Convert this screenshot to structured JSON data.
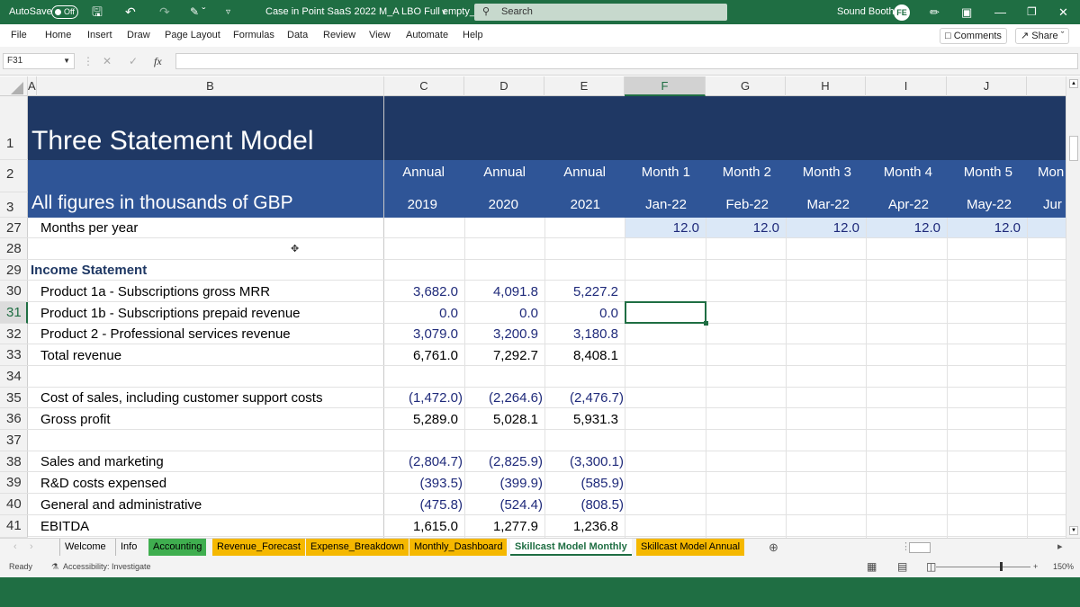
{
  "titlebar": {
    "autosave_label": "AutoSave",
    "autosave_state": "Off",
    "file_title": "Case in Point SaaS 2022 M_A LBO Full empty_6",
    "search_placeholder": "Search",
    "user_name": "Sound Booth",
    "user_initials": "FE"
  },
  "menu": [
    "File",
    "Home",
    "Insert",
    "Draw",
    "Page Layout",
    "Formulas",
    "Data",
    "Review",
    "View",
    "Automate",
    "Help"
  ],
  "comments_label": "Comments",
  "share_label": "Share",
  "formula_bar": {
    "name_box": "F31",
    "fx": "fx",
    "formula": ""
  },
  "columns": [
    "A",
    "B",
    "C",
    "D",
    "E",
    "F",
    "G",
    "H",
    "I",
    "J"
  ],
  "selected_column": "F",
  "rows": {
    "r1": {
      "num": "1",
      "title": "Three Statement Model"
    },
    "r2": {
      "num": "2",
      "headers": [
        "Annual",
        "Annual",
        "Annual",
        "Month 1",
        "Month 2",
        "Month 3",
        "Month 4",
        "Month 5",
        "Mon"
      ]
    },
    "r3": {
      "num": "3",
      "label": "All figures in thousands of GBP",
      "headers": [
        "2019",
        "2020",
        "2021",
        "Jan-22",
        "Feb-22",
        "Mar-22",
        "Apr-22",
        "May-22",
        "Jur"
      ]
    },
    "r27": {
      "num": "27",
      "label": "Months per year",
      "values": [
        "12.0",
        "12.0",
        "12.0",
        "12.0",
        "12.0"
      ]
    },
    "r28": {
      "num": "28"
    },
    "r29": {
      "num": "29",
      "label": "Income Statement"
    },
    "r30": {
      "num": "30",
      "label": "Product 1a - Subscriptions gross MRR",
      "values": [
        "3,682.0",
        "4,091.8",
        "5,227.2"
      ]
    },
    "r31": {
      "num": "31",
      "label": "Product 1b - Subscriptions prepaid revenue",
      "values": [
        "0.0",
        "0.0",
        "0.0"
      ]
    },
    "r32": {
      "num": "32",
      "label": "Product 2 - Professional services revenue",
      "values": [
        "3,079.0",
        "3,200.9",
        "3,180.8"
      ]
    },
    "r33": {
      "num": "33",
      "label": "Total revenue",
      "values": [
        "6,761.0",
        "7,292.7",
        "8,408.1"
      ]
    },
    "r34": {
      "num": "34"
    },
    "r35": {
      "num": "35",
      "label": "Cost of sales, including customer support costs",
      "values": [
        "(1,472.0)",
        "(2,264.6)",
        "(2,476.7)"
      ]
    },
    "r36": {
      "num": "36",
      "label": "Gross profit",
      "values": [
        "5,289.0",
        "5,028.1",
        "5,931.3"
      ]
    },
    "r37": {
      "num": "37"
    },
    "r38": {
      "num": "38",
      "label": "Sales and marketing",
      "values": [
        "(2,804.7)",
        "(2,825.9)",
        "(3,300.1)"
      ]
    },
    "r39": {
      "num": "39",
      "label": "R&D costs expensed",
      "values": [
        "(393.5)",
        "(399.9)",
        "(585.9)"
      ]
    },
    "r40": {
      "num": "40",
      "label": "General and administrative",
      "values": [
        "(475.8)",
        "(524.4)",
        "(808.5)"
      ]
    },
    "r41": {
      "num": "41",
      "label": "EBITDA",
      "values": [
        "1,615.0",
        "1,277.9",
        "1,236.8"
      ]
    }
  },
  "sheet_tabs": [
    {
      "label": "Welcome",
      "color": ""
    },
    {
      "label": "Info",
      "color": ""
    },
    {
      "label": "Accounting",
      "color": "#3fae4f"
    },
    {
      "label": "Revenue_Forecast",
      "color": "#f5b800"
    },
    {
      "label": "Expense_Breakdown",
      "color": "#f5b800"
    },
    {
      "label": "Monthly_Dashboard",
      "color": "#f5b800"
    },
    {
      "label": "Skillcast Model Monthly",
      "color": "",
      "active": true
    },
    {
      "label": "Skillcast Model Annual",
      "color": "#f5b800"
    }
  ],
  "status": {
    "ready": "Ready",
    "accessibility": "Accessibility: Investigate",
    "zoom": "150%"
  },
  "colors": {
    "excel_green": "#1f6e43",
    "title_band": "#1f3864",
    "header_band": "#2f5597",
    "highlight_band": "#dbe8f7",
    "input_blue": "#1f2a7a"
  }
}
